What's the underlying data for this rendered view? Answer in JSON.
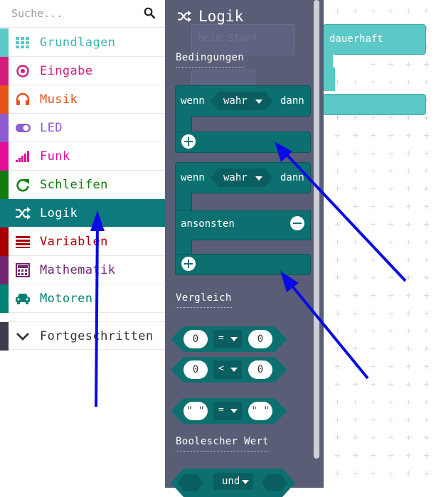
{
  "search": {
    "placeholder": "Suche..."
  },
  "categories": [
    {
      "label": "Grundlagen",
      "color": "#5cc8c8",
      "icon": "grid-icon"
    },
    {
      "label": "Eingabe",
      "color": "#d41c7b",
      "icon": "target-icon"
    },
    {
      "label": "Musik",
      "color": "#e5531a",
      "icon": "headphones-icon"
    },
    {
      "label": "LED",
      "color": "#8b5ccf",
      "icon": "toggle-icon"
    },
    {
      "label": "Funk",
      "color": "#e40e94",
      "icon": "signal-icon"
    },
    {
      "label": "Schleifen",
      "color": "#107c10",
      "icon": "refresh-icon"
    },
    {
      "label": "Logik",
      "color": "#0d7a7e",
      "icon": "shuffle-icon",
      "active": true
    },
    {
      "label": "Variablen",
      "color": "#a80000",
      "icon": "list-icon"
    },
    {
      "label": "Mathematik",
      "color": "#712672",
      "icon": "calculator-icon"
    },
    {
      "label": "Motoren",
      "color": "#008272",
      "icon": "car-icon"
    }
  ],
  "advanced": {
    "label": "Fortgeschritten",
    "color": "#3c3c4c"
  },
  "flyout": {
    "title": "Logik",
    "ghost_text": "beim Start",
    "sections": {
      "conditions": "Bedingungen",
      "comparison": "Vergleich",
      "boolean": "Boolescher Wert"
    },
    "if_block": {
      "wenn": "wenn",
      "wahr": "wahr",
      "dann": "dann"
    },
    "if_else_block": {
      "wenn": "wenn",
      "wahr": "wahr",
      "dann": "dann",
      "else": "ansonsten"
    },
    "compare": [
      {
        "left": "0",
        "op": "=",
        "right": "0"
      },
      {
        "left": "0",
        "op": "<",
        "right": "0"
      },
      {
        "left": "\" \"",
        "op": "=",
        "right": "\" \""
      }
    ],
    "and_block": {
      "label": "und"
    }
  },
  "workspace": {
    "forever_label": "dauerhaft"
  },
  "colors": {
    "flyout_bg": "#595e76",
    "logic": "#0d7070",
    "annotation": "#0a0ae6"
  }
}
